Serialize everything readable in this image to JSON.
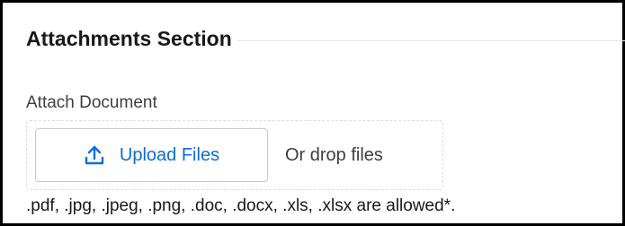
{
  "section": {
    "title": "Attachments Section"
  },
  "field": {
    "label": "Attach Document",
    "upload_button_label": "Upload Files",
    "upload_icon": "upload-icon",
    "drop_hint": "Or drop files",
    "allowed_types_note": ".pdf, .jpg, .jpeg, .png, .doc, .docx, .xls, .xlsx are allowed*."
  },
  "colors": {
    "accent": "#0b6cd6",
    "border": "#000000"
  }
}
